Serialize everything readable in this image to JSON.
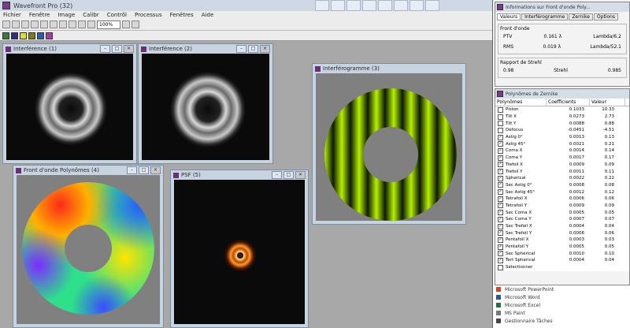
{
  "app": {
    "title": "Wavefront Pro (32)"
  },
  "menu": [
    "Fichier",
    "Fenêtre",
    "Image",
    "Calibr",
    "Contrôl",
    "Processus",
    "Fenêtres",
    "Aide"
  ],
  "toolbar": {
    "zoom_combo": "100%"
  },
  "windows": {
    "w1": {
      "title": "Interférence (1)"
    },
    "w2": {
      "title": "Interférence (2)"
    },
    "w3": {
      "title": "Interférogramme (3)"
    },
    "w4": {
      "title": "Front d'onde Polynômes (4)"
    },
    "w5": {
      "title": "PSF (5)"
    }
  },
  "info_panel": {
    "title": "Informations sur Front d'onde Poly...",
    "tabs": [
      "Valeurs",
      "Interférogramme",
      "Zernike",
      "Options"
    ],
    "group1_label": "Front d'onde",
    "group2_label": "Rapport de Strehl",
    "rows": [
      {
        "k": "PTV",
        "v": "0.161 λ",
        "u": "Lambda/6.2"
      },
      {
        "k": "RMS",
        "v": "0.019 λ",
        "u": "Lambda/52.1"
      },
      {
        "k": "0.98",
        "v": "Strehl",
        "u": "0.985"
      }
    ]
  },
  "zernike_panel": {
    "title": "Polynômes de Zernike",
    "headers": [
      "Polynômes",
      "Coefficients",
      "Valeur"
    ],
    "terms": [
      {
        "checked": false,
        "name": "Piston",
        "coef": "0.1033",
        "val": "10.33"
      },
      {
        "checked": false,
        "name": "Tilt X",
        "coef": "0.0273",
        "val": "2.73"
      },
      {
        "checked": false,
        "name": "Tilt Y",
        "coef": "0.0088",
        "val": "0.88"
      },
      {
        "checked": false,
        "name": "Defocus",
        "coef": "-0.0451",
        "val": "-4.51"
      },
      {
        "checked": true,
        "name": "Astig 0°",
        "coef": "0.0013",
        "val": "0.13"
      },
      {
        "checked": true,
        "name": "Astig 45°",
        "coef": "0.0021",
        "val": "0.21"
      },
      {
        "checked": true,
        "name": "Coma X",
        "coef": "0.0014",
        "val": "0.14"
      },
      {
        "checked": true,
        "name": "Coma Y",
        "coef": "0.0017",
        "val": "0.17"
      },
      {
        "checked": true,
        "name": "Trefoil X",
        "coef": "0.0009",
        "val": "0.09"
      },
      {
        "checked": true,
        "name": "Trefoil Y",
        "coef": "0.0011",
        "val": "0.11"
      },
      {
        "checked": true,
        "name": "Spherical",
        "coef": "0.0022",
        "val": "0.22"
      },
      {
        "checked": true,
        "name": "Sec Astig 0°",
        "coef": "0.0008",
        "val": "0.08"
      },
      {
        "checked": true,
        "name": "Sec Astig 45°",
        "coef": "0.0012",
        "val": "0.12"
      },
      {
        "checked": true,
        "name": "Tetrafoil X",
        "coef": "0.0006",
        "val": "0.06"
      },
      {
        "checked": true,
        "name": "Tetrafoil Y",
        "coef": "0.0009",
        "val": "0.09"
      },
      {
        "checked": true,
        "name": "Sec Coma X",
        "coef": "0.0005",
        "val": "0.05"
      },
      {
        "checked": true,
        "name": "Sec Coma Y",
        "coef": "0.0007",
        "val": "0.07"
      },
      {
        "checked": true,
        "name": "Sec Trefoil X",
        "coef": "0.0004",
        "val": "0.04"
      },
      {
        "checked": true,
        "name": "Sec Trefoil Y",
        "coef": "0.0006",
        "val": "0.06"
      },
      {
        "checked": true,
        "name": "Pentafoil X",
        "coef": "0.0003",
        "val": "0.03"
      },
      {
        "checked": true,
        "name": "Pentafoil Y",
        "coef": "0.0005",
        "val": "0.05"
      },
      {
        "checked": true,
        "name": "Sec Spherical",
        "coef": "0.0010",
        "val": "0.10"
      },
      {
        "checked": true,
        "name": "Tert Spherical",
        "coef": "0.0004",
        "val": "0.04"
      },
      {
        "checked": false,
        "name": "Sélectionner",
        "coef": "",
        "val": ""
      }
    ]
  },
  "start_list": [
    {
      "label": "Microsoft PowerPoint",
      "color": "#d24726"
    },
    {
      "label": "Microsoft Word",
      "color": "#2b579a"
    },
    {
      "label": "Microsoft Excel",
      "color": "#217346"
    },
    {
      "label": "MS Paint",
      "color": "#777777"
    },
    {
      "label": "Gestionnaire Tâches",
      "color": "#444444"
    }
  ]
}
